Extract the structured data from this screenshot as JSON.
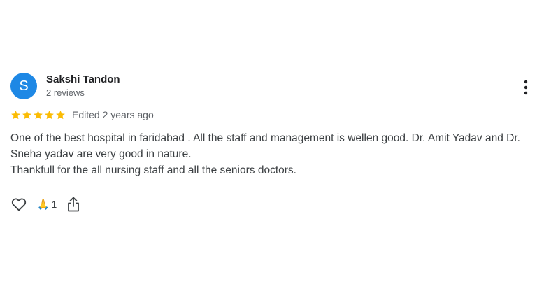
{
  "review": {
    "author": {
      "initial": "S",
      "name": "Sakshi Tandon",
      "review_count": "2 reviews",
      "avatar_color": "#1e88e5"
    },
    "rating": 5,
    "star_color": "#fbbc04",
    "date": "Edited 2 years ago",
    "text_lines": [
      "One of the best hospital in faridabad . All the staff and management is wellen good. Dr. Amit Yadav and Dr. Sneha yadav are very good in nature.",
      "Thankfull for the all nursing staff and all the seniors doctors."
    ],
    "reactions": {
      "emoji": "🙏",
      "count": "1"
    },
    "icons": {
      "like": "heart-outline-icon",
      "share": "share-icon",
      "more": "more-vertical-icon",
      "star": "star-icon"
    }
  }
}
